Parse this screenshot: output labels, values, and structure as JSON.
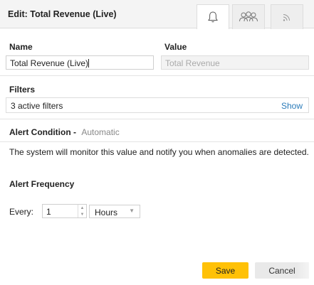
{
  "header": {
    "title": "Edit: Total Revenue (Live)",
    "tabs": [
      {
        "icon": "bell-icon",
        "active": true
      },
      {
        "icon": "users-icon",
        "active": false
      },
      {
        "icon": "rss-icon",
        "active": false
      }
    ]
  },
  "fields": {
    "name_label": "Name",
    "name_value": "Total Revenue (Live)",
    "value_label": "Value",
    "value_placeholder": "Total Revenue"
  },
  "filters": {
    "label": "Filters",
    "summary": "3 active filters",
    "show_link": "Show"
  },
  "alert_condition": {
    "label": "Alert Condition",
    "separator": "-",
    "mode": "Automatic",
    "description": "The system will monitor this value and notify you when anomalies are detected."
  },
  "alert_frequency": {
    "label": "Alert Frequency",
    "every_label": "Every:",
    "interval_value": "1",
    "unit_selected": "Hours"
  },
  "footer": {
    "save_label": "Save",
    "cancel_label": "Cancel"
  },
  "colors": {
    "accent_save": "#ffc107",
    "link": "#2b7bb9"
  }
}
